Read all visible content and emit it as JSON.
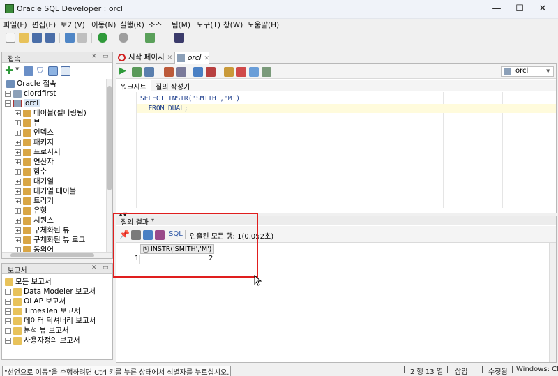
{
  "window": {
    "title": "Oracle SQL Developer : orcl",
    "minimize": "—",
    "maximize": "☐",
    "close": "✕"
  },
  "menu": [
    "파일(F)",
    "편집(E)",
    "보기(V)",
    "이동(N)",
    "실행(R)",
    "소스",
    "팀(M)",
    "도구(T)",
    "창(W)",
    "도움말(H)"
  ],
  "connections_panel": {
    "title": "접속",
    "root": "Oracle 접속",
    "items": [
      "clordfirst",
      "orcl"
    ],
    "children": [
      "테이블(필터링됨)",
      "뷰",
      "인덱스",
      "패키지",
      "프로시저",
      "연산자",
      "함수",
      "대기열",
      "대기열 테이블",
      "트리거",
      "유형",
      "시퀀스",
      "구체화된 뷰",
      "구체화된 뷰 로그",
      "동의어"
    ]
  },
  "reports_panel": {
    "title": "보고서",
    "root": "모든 보고서",
    "items": [
      "Data Modeler 보고서",
      "OLAP 보고서",
      "TimesTen 보고서",
      "데이터 딕셔너리 보고서",
      "분석 뷰 보고서",
      "사용자정의 보고서"
    ]
  },
  "editor": {
    "tabs": [
      "시작 페이지",
      "orcl"
    ],
    "connection_selector": "orcl",
    "subtabs": [
      "워크시트",
      "질의 작성기"
    ],
    "code_lines": [
      "SELECT INSTR('SMITH','M')",
      "  FROM DUAL;"
    ]
  },
  "results": {
    "tab_label": "질의 결과",
    "sql_label": "SQL",
    "status": "인출된 모든 행: 1(0,052초)",
    "columns": [
      "INSTR('SMITH','M')"
    ],
    "rows": [
      {
        "num": "1",
        "values": [
          "2"
        ]
      }
    ]
  },
  "statusbar": {
    "hint": "\"선언으로 이동\"을 수행하려면 Ctrl 키를 누른 상태에서 식별자를 누르십시오.",
    "position": "2 행 13 열",
    "mode": "삽입",
    "modified": "수정됨",
    "platform": "Windows: CR"
  },
  "colors": {
    "highlight_box": "#e01e1e",
    "sql_text": "#1c3d8c",
    "current_line": "#fffbdc"
  }
}
